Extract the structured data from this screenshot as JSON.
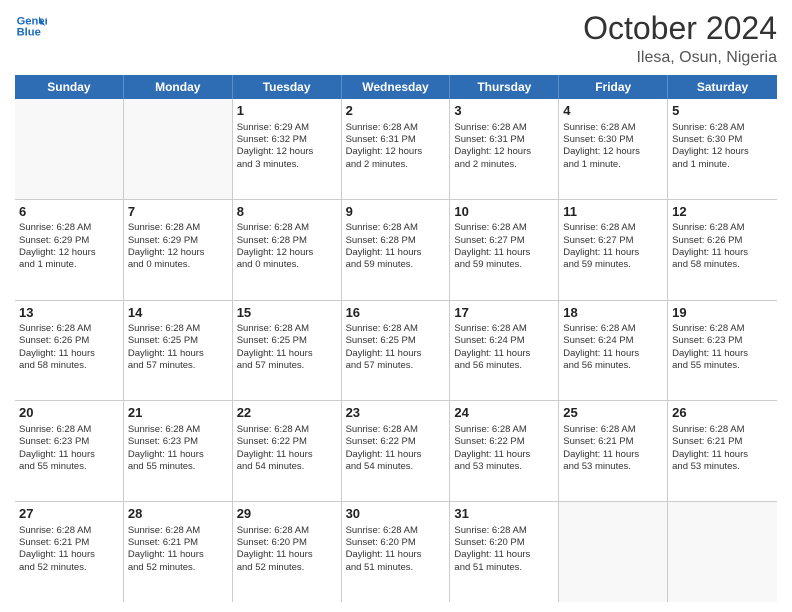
{
  "header": {
    "logo_line1": "General",
    "logo_line2": "Blue",
    "month": "October 2024",
    "location": "Ilesa, Osun, Nigeria"
  },
  "weekdays": [
    "Sunday",
    "Monday",
    "Tuesday",
    "Wednesday",
    "Thursday",
    "Friday",
    "Saturday"
  ],
  "rows": [
    [
      {
        "day": "",
        "text": ""
      },
      {
        "day": "",
        "text": ""
      },
      {
        "day": "1",
        "text": "Sunrise: 6:29 AM\nSunset: 6:32 PM\nDaylight: 12 hours\nand 3 minutes."
      },
      {
        "day": "2",
        "text": "Sunrise: 6:28 AM\nSunset: 6:31 PM\nDaylight: 12 hours\nand 2 minutes."
      },
      {
        "day": "3",
        "text": "Sunrise: 6:28 AM\nSunset: 6:31 PM\nDaylight: 12 hours\nand 2 minutes."
      },
      {
        "day": "4",
        "text": "Sunrise: 6:28 AM\nSunset: 6:30 PM\nDaylight: 12 hours\nand 1 minute."
      },
      {
        "day": "5",
        "text": "Sunrise: 6:28 AM\nSunset: 6:30 PM\nDaylight: 12 hours\nand 1 minute."
      }
    ],
    [
      {
        "day": "6",
        "text": "Sunrise: 6:28 AM\nSunset: 6:29 PM\nDaylight: 12 hours\nand 1 minute."
      },
      {
        "day": "7",
        "text": "Sunrise: 6:28 AM\nSunset: 6:29 PM\nDaylight: 12 hours\nand 0 minutes."
      },
      {
        "day": "8",
        "text": "Sunrise: 6:28 AM\nSunset: 6:28 PM\nDaylight: 12 hours\nand 0 minutes."
      },
      {
        "day": "9",
        "text": "Sunrise: 6:28 AM\nSunset: 6:28 PM\nDaylight: 11 hours\nand 59 minutes."
      },
      {
        "day": "10",
        "text": "Sunrise: 6:28 AM\nSunset: 6:27 PM\nDaylight: 11 hours\nand 59 minutes."
      },
      {
        "day": "11",
        "text": "Sunrise: 6:28 AM\nSunset: 6:27 PM\nDaylight: 11 hours\nand 59 minutes."
      },
      {
        "day": "12",
        "text": "Sunrise: 6:28 AM\nSunset: 6:26 PM\nDaylight: 11 hours\nand 58 minutes."
      }
    ],
    [
      {
        "day": "13",
        "text": "Sunrise: 6:28 AM\nSunset: 6:26 PM\nDaylight: 11 hours\nand 58 minutes."
      },
      {
        "day": "14",
        "text": "Sunrise: 6:28 AM\nSunset: 6:25 PM\nDaylight: 11 hours\nand 57 minutes."
      },
      {
        "day": "15",
        "text": "Sunrise: 6:28 AM\nSunset: 6:25 PM\nDaylight: 11 hours\nand 57 minutes."
      },
      {
        "day": "16",
        "text": "Sunrise: 6:28 AM\nSunset: 6:25 PM\nDaylight: 11 hours\nand 57 minutes."
      },
      {
        "day": "17",
        "text": "Sunrise: 6:28 AM\nSunset: 6:24 PM\nDaylight: 11 hours\nand 56 minutes."
      },
      {
        "day": "18",
        "text": "Sunrise: 6:28 AM\nSunset: 6:24 PM\nDaylight: 11 hours\nand 56 minutes."
      },
      {
        "day": "19",
        "text": "Sunrise: 6:28 AM\nSunset: 6:23 PM\nDaylight: 11 hours\nand 55 minutes."
      }
    ],
    [
      {
        "day": "20",
        "text": "Sunrise: 6:28 AM\nSunset: 6:23 PM\nDaylight: 11 hours\nand 55 minutes."
      },
      {
        "day": "21",
        "text": "Sunrise: 6:28 AM\nSunset: 6:23 PM\nDaylight: 11 hours\nand 55 minutes."
      },
      {
        "day": "22",
        "text": "Sunrise: 6:28 AM\nSunset: 6:22 PM\nDaylight: 11 hours\nand 54 minutes."
      },
      {
        "day": "23",
        "text": "Sunrise: 6:28 AM\nSunset: 6:22 PM\nDaylight: 11 hours\nand 54 minutes."
      },
      {
        "day": "24",
        "text": "Sunrise: 6:28 AM\nSunset: 6:22 PM\nDaylight: 11 hours\nand 53 minutes."
      },
      {
        "day": "25",
        "text": "Sunrise: 6:28 AM\nSunset: 6:21 PM\nDaylight: 11 hours\nand 53 minutes."
      },
      {
        "day": "26",
        "text": "Sunrise: 6:28 AM\nSunset: 6:21 PM\nDaylight: 11 hours\nand 53 minutes."
      }
    ],
    [
      {
        "day": "27",
        "text": "Sunrise: 6:28 AM\nSunset: 6:21 PM\nDaylight: 11 hours\nand 52 minutes."
      },
      {
        "day": "28",
        "text": "Sunrise: 6:28 AM\nSunset: 6:21 PM\nDaylight: 11 hours\nand 52 minutes."
      },
      {
        "day": "29",
        "text": "Sunrise: 6:28 AM\nSunset: 6:20 PM\nDaylight: 11 hours\nand 52 minutes."
      },
      {
        "day": "30",
        "text": "Sunrise: 6:28 AM\nSunset: 6:20 PM\nDaylight: 11 hours\nand 51 minutes."
      },
      {
        "day": "31",
        "text": "Sunrise: 6:28 AM\nSunset: 6:20 PM\nDaylight: 11 hours\nand 51 minutes."
      },
      {
        "day": "",
        "text": ""
      },
      {
        "day": "",
        "text": ""
      }
    ]
  ]
}
